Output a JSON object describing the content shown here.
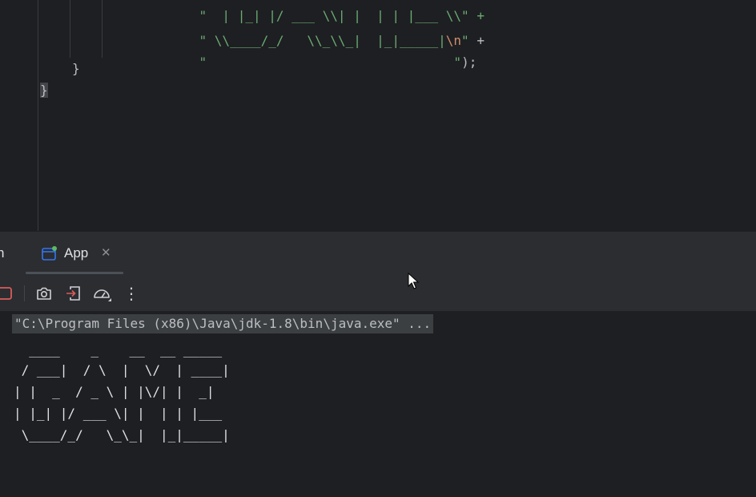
{
  "editor": {
    "lines": [
      {
        "prefix": "",
        "string": "\"  | |_| |/ ___ \\\\| |  | | |___ \\\\",
        "tail": "\" +"
      },
      {
        "prefix": "",
        "string": "\" \\\\____/_/   \\\\_\\\\_|  |_|_____|",
        "esc": "\\n",
        "close": "\"",
        "tail": " +"
      },
      {
        "prefix": "",
        "string": "\"                                ",
        "close": "\"",
        "tail": ");"
      }
    ],
    "closing_brace_inner": "}",
    "closing_brace_outer": "}"
  },
  "run_panel": {
    "partial_tab_label": "n",
    "tab_label": "App",
    "close_glyph": "✕"
  },
  "toolbar": {
    "buttons": [
      "stop-icon",
      "camera-icon",
      "exit-icon",
      "speedometer-icon",
      "more-icon"
    ],
    "more_glyph": "⋮"
  },
  "console": {
    "command": "\"C:\\Program Files (x86)\\Java\\jdk-1.8\\bin\\java.exe\" ...",
    "output": [
      "  ____    _    __  __ _____",
      " / ___|  / \\  |  \\/  | ____|",
      "| |  _  / _ \\ | |\\/| |  _|",
      "| |_| |/ ___ \\| |  | | |___",
      " \\____/_/   \\_\\_|  |_|_____|"
    ]
  },
  "colors": {
    "background": "#1e1f22",
    "panel": "#2b2d30",
    "string": "#6aab73",
    "escape": "#cf8e6d",
    "stop": "#db5c5c",
    "accent": "#3574f0",
    "run_dot": "#5fb865"
  }
}
